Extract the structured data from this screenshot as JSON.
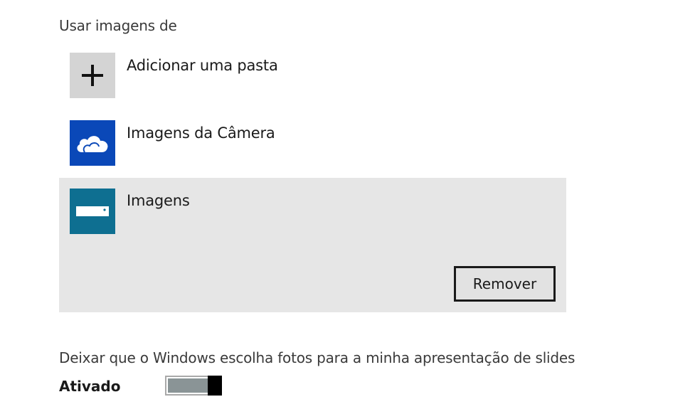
{
  "section": {
    "title": "Usar imagens de"
  },
  "folders": [
    {
      "label": "Adicionar uma pasta",
      "icon": "plus-icon",
      "tile_color": "#d4d4d4"
    },
    {
      "label": "Imagens da Câmera",
      "icon": "onedrive-cloud-icon",
      "tile_color": "#0a48b8"
    },
    {
      "label": "Imagens",
      "icon": "drive-icon",
      "tile_color": "#0e6f91",
      "selected": true
    }
  ],
  "remove_button": {
    "label": "Remover"
  },
  "slideshow": {
    "label": "Deixar que o Windows escolha fotos para a minha apresentação de slides",
    "state_label": "Ativado",
    "toggle_on": true
  }
}
